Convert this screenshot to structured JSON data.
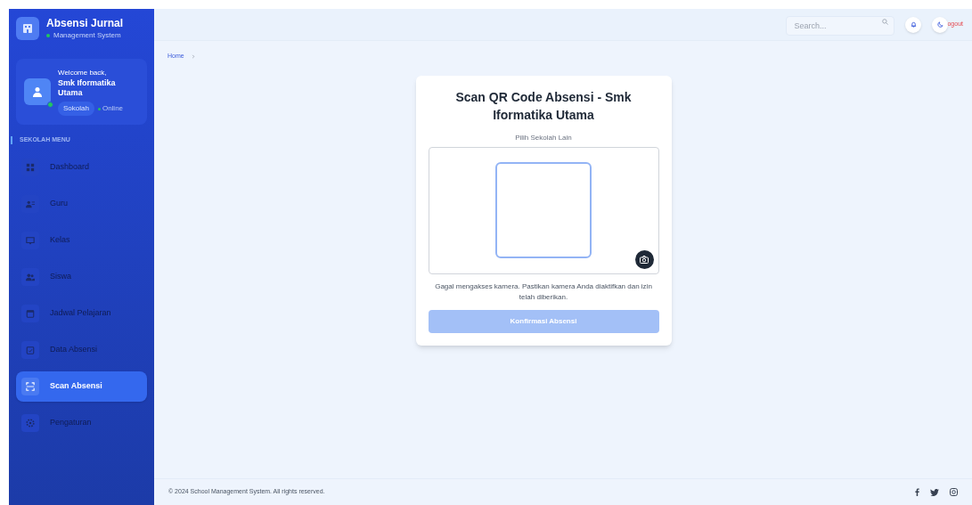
{
  "brand": {
    "title": "Absensi Jurnal",
    "subtitle": "Management System"
  },
  "user": {
    "greeting": "Welcome back,",
    "name": "Smk Iformatika Utama",
    "role": "Sokolah",
    "status": "Online",
    "online": true
  },
  "sidebar": {
    "heading": "SEKOLAH MENU",
    "items": [
      {
        "label": "Dashboard",
        "selected": false
      },
      {
        "label": "Guru",
        "selected": false
      },
      {
        "label": "Kelas",
        "selected": false
      },
      {
        "label": "Siswa",
        "selected": false
      },
      {
        "label": "Jadwal Pelajaran",
        "selected": false
      },
      {
        "label": "Data Absensi",
        "selected": false
      },
      {
        "label": "Scan Absensi",
        "selected": true
      },
      {
        "label": "Pengaturan",
        "selected": false
      }
    ]
  },
  "header": {
    "search": {
      "placeholder": "Search..."
    },
    "logout": "ogout"
  },
  "breadcrumb": [
    "Home"
  ],
  "card": {
    "title": "Scan QR Code Absensi - Smk Iformatika Utama",
    "school_link": "Pilih Sekolah Lain",
    "error": "Gagal mengakses kamera. Pastikan kamera Anda diaktifkan dan izin telah diberikan.",
    "button": {
      "label": "Konfirmasi Absensi",
      "disabled": true
    }
  },
  "footer": {
    "copyright": "© 2024 School Management System. All rights reserved."
  }
}
